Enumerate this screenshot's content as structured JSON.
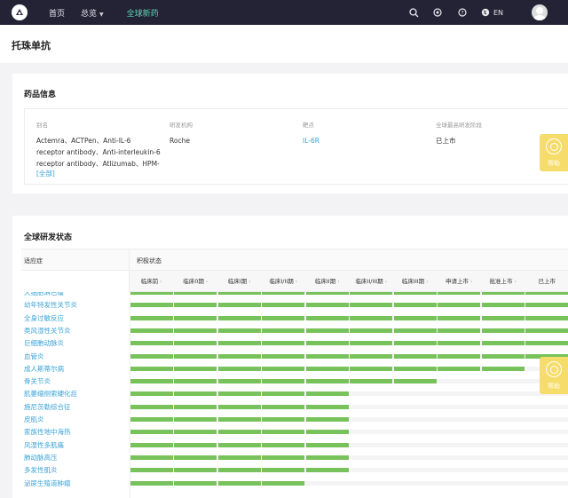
{
  "nav": {
    "items": [
      {
        "label": "首页"
      },
      {
        "label": "总览"
      },
      {
        "label": "全球新药"
      }
    ],
    "lang": "EN"
  },
  "page": {
    "title": "托珠单抗"
  },
  "drug_info": {
    "title": "药品信息",
    "alias_label": "别名",
    "alias_lines": [
      "Actemra、ACTPen、Anti-IL-6",
      "receptor antibody、Anti-interleukin-6",
      "receptor antibody、Atlizumab、HPM-"
    ],
    "alias_more": "[全部]",
    "org_label": "研发机构",
    "org_value": "Roche",
    "target_label": "靶点",
    "target_value": "IL-6R",
    "phase_label": "全球最高研发阶段",
    "phase_value": "已上市"
  },
  "help": {
    "label": "帮助"
  },
  "global_status": {
    "title": "全球研发状态",
    "indication_header": "适应症",
    "activity_header": "积极状态",
    "phases": [
      "临床前",
      "临床0期",
      "临床I期",
      "临床I/II期",
      "临床II期",
      "临床II/III期",
      "临床III期",
      "申请上市",
      "批准上市",
      "已上市"
    ],
    "rows": [
      {
        "label": "大细胞淋巴瘤",
        "progress": 10
      },
      {
        "label": "幼年特发性关节炎",
        "progress": 10
      },
      {
        "label": "全身过敏反应",
        "progress": 10
      },
      {
        "label": "类风湿性关节炎",
        "progress": 10
      },
      {
        "label": "巨细胞动脉炎",
        "progress": 10
      },
      {
        "label": "血管炎",
        "progress": 10
      },
      {
        "label": "成人斯蒂尔病",
        "progress": 9
      },
      {
        "label": "骨关节炎",
        "progress": 7
      },
      {
        "label": "肌萎缩侧索硬化症",
        "progress": 5
      },
      {
        "label": "施尼茨勒综合征",
        "progress": 5
      },
      {
        "label": "皮肌炎",
        "progress": 5
      },
      {
        "label": "家族性地中海热",
        "progress": 5
      },
      {
        "label": "风湿性多肌痛",
        "progress": 5
      },
      {
        "label": "肺动脉高压",
        "progress": 5
      },
      {
        "label": "多发性肌炎",
        "progress": 5
      },
      {
        "label": "泌尿生殖道肿瘤",
        "progress": 4
      }
    ]
  }
}
